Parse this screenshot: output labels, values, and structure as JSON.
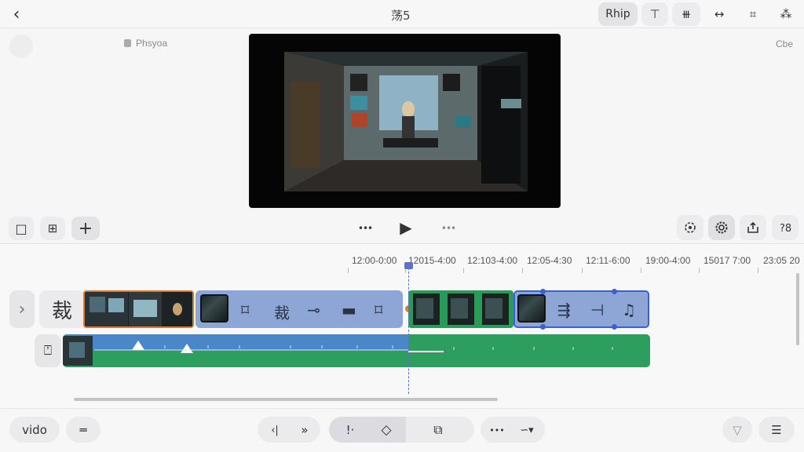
{
  "header": {
    "title": "荡5",
    "buttons": {
      "rhip": "Rhip",
      "filters": "⊤",
      "layers": "⧻",
      "transitions": "↔",
      "calendar": "⌗",
      "effects": "⁂"
    }
  },
  "preview": {
    "left_label": "Phsyoa",
    "right_label": "Cbe"
  },
  "toolbar": {
    "crop": "□",
    "split": "⊞",
    "add": "+",
    "prev": "•••",
    "play": "▶",
    "next": "•••"
  },
  "timeline": {
    "ticks": [
      "12:00-0:00",
      "12015-4:00",
      "12:103-4:00",
      "12:05-4:30",
      "12:11-6:00",
      "19:00-4:00",
      "15017 7:00",
      "23:05 20"
    ],
    "expand": "›",
    "crop_glyph": "裁",
    "clip_icons": [
      "⌑",
      "裁",
      "⊸",
      "▬",
      "⌑"
    ],
    "clip_icons_right": [
      "⇶",
      "⊣",
      "♫"
    ],
    "audio_icon": "⍞"
  },
  "bottom": {
    "video_label": "vido",
    "equals": "═",
    "skip_back": "‹|",
    "skip_fwd": "»",
    "mark": "!·",
    "keyframe": "◇",
    "replace": "⧉",
    "more": "•••",
    "speed": "∽▾",
    "filter": "▽",
    "menu": "☰"
  }
}
